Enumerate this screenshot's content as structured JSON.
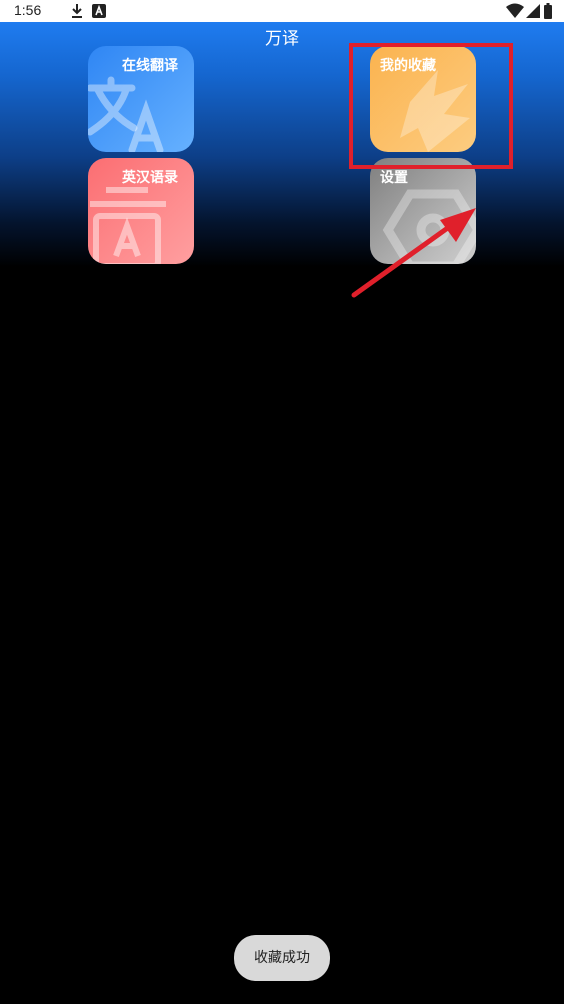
{
  "status_bar": {
    "time": "1:56",
    "icons": [
      "download-icon",
      "font-a-icon",
      "wifi-icon",
      "signal-icon",
      "battery-icon"
    ]
  },
  "app": {
    "title": "万译"
  },
  "tiles": [
    {
      "label": "在线翻译",
      "icon": "translate-icon",
      "color": "#3a8ef7"
    },
    {
      "label": "我的收藏",
      "icon": "bird-star-icon",
      "color": "#fbbb60"
    },
    {
      "label": "英汉语录",
      "icon": "document-a-icon",
      "color": "#fd7b7e"
    },
    {
      "label": "设置",
      "icon": "gear-hex-icon",
      "color": "#9e9e9e"
    }
  ],
  "annotation": {
    "highlight_color": "#e0202b"
  },
  "toast": {
    "text": "收藏成功"
  }
}
